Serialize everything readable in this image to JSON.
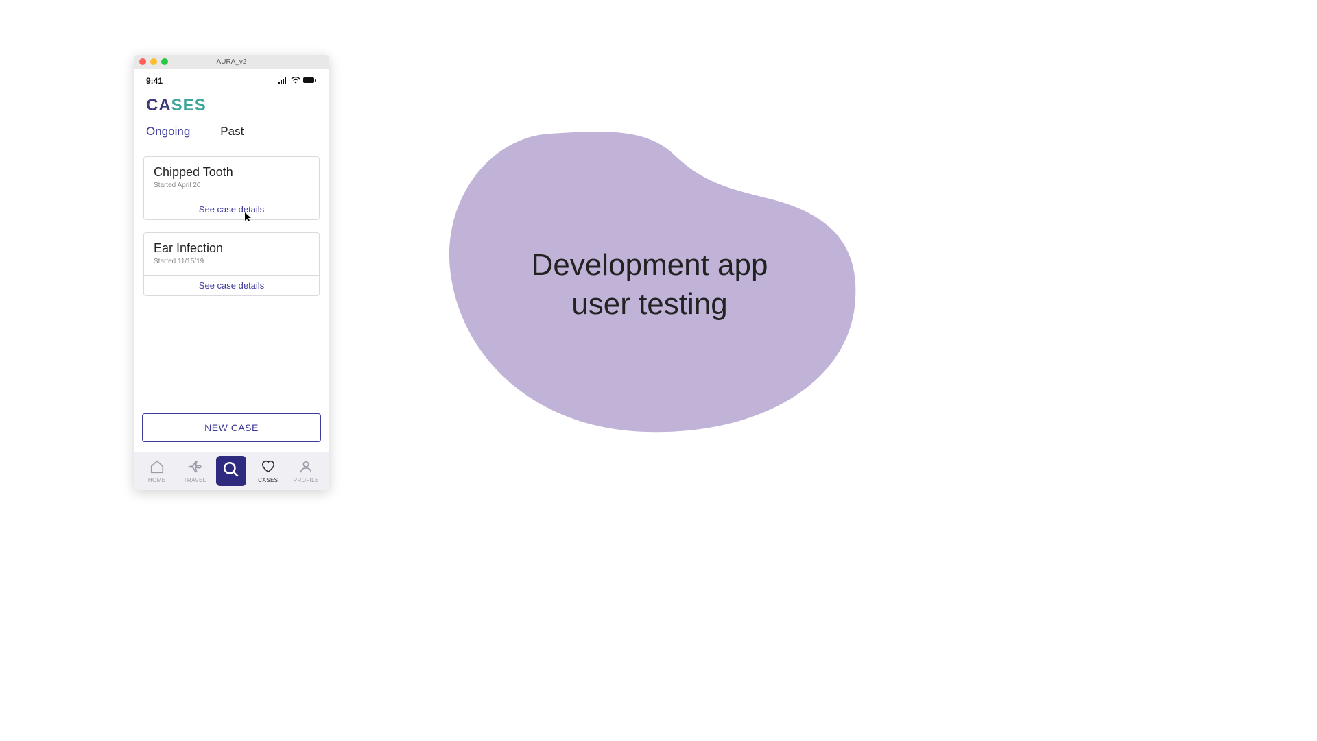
{
  "window": {
    "title": "AURA_v2"
  },
  "status": {
    "time": "9:41"
  },
  "page": {
    "title_part1": "CA",
    "title_part2": "SES"
  },
  "tabs": {
    "ongoing": "Ongoing",
    "past": "Past"
  },
  "cases": [
    {
      "title": "Chipped Tooth",
      "subtitle": "Started April 20",
      "action": "See case details"
    },
    {
      "title": "Ear Infection",
      "subtitle": "Started 11/15/19",
      "action": "See case details"
    }
  ],
  "new_case_label": "NEW CASE",
  "nav": {
    "home": "HOME",
    "travel": "TRAVEL",
    "cases": "CASES",
    "profile": "PROFILE"
  },
  "slide": {
    "line1": "Development app",
    "line2": "user testing"
  },
  "colors": {
    "accent": "#3d3a9a",
    "teal": "#3da69c",
    "blob": "#c0b3d7"
  }
}
